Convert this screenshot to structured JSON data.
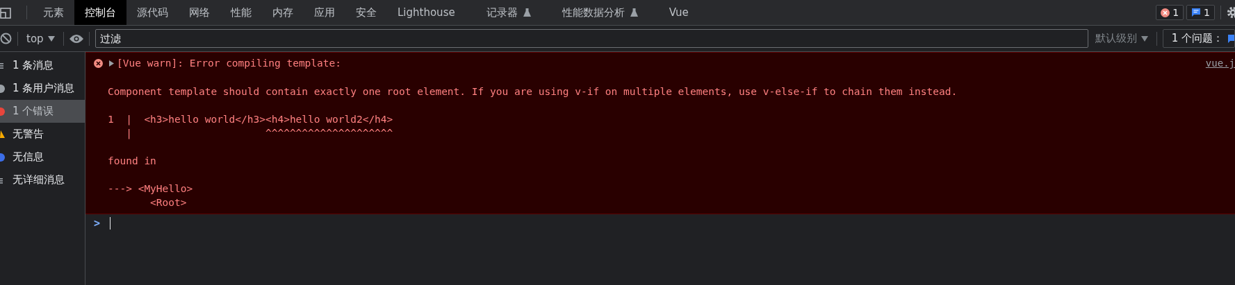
{
  "tabs": [
    {
      "label": "元素",
      "selected": false,
      "flask": false
    },
    {
      "label": "控制台",
      "selected": true,
      "flask": false
    },
    {
      "label": "源代码",
      "selected": false,
      "flask": false
    },
    {
      "label": "网络",
      "selected": false,
      "flask": false
    },
    {
      "label": "性能",
      "selected": false,
      "flask": false
    },
    {
      "label": "内存",
      "selected": false,
      "flask": false
    },
    {
      "label": "应用",
      "selected": false,
      "flask": false
    },
    {
      "label": "安全",
      "selected": false,
      "flask": false
    },
    {
      "label": "Lighthouse",
      "selected": false,
      "flask": false
    },
    {
      "label": "记录器",
      "selected": false,
      "flask": true
    },
    {
      "label": "性能数据分析",
      "selected": false,
      "flask": true
    },
    {
      "label": "Vue",
      "selected": false,
      "flask": false
    }
  ],
  "counters": [
    {
      "kind": "error",
      "count": "1"
    },
    {
      "kind": "message",
      "count": "1"
    }
  ],
  "toolbar": {
    "context": "top",
    "filter": {
      "placeholder": "过滤"
    },
    "levels": "默认级别",
    "issues": "1 个问题："
  },
  "sidebar": {
    "items": [
      {
        "label": "1 条消息",
        "kind": "list",
        "selected": false
      },
      {
        "label": "1 条用户消息",
        "kind": "user",
        "selected": false
      },
      {
        "label": "1 个错误",
        "kind": "error",
        "selected": true
      },
      {
        "label": "无警告",
        "kind": "warning",
        "selected": false
      },
      {
        "label": "无信息",
        "kind": "info",
        "selected": false
      },
      {
        "label": "无详细消息",
        "kind": "verbose",
        "selected": false
      }
    ]
  },
  "console": {
    "messages": [
      {
        "kind": "error",
        "summary": "[Vue warn]: Error compiling template:",
        "source": "vue.j",
        "blocks": [
          [
            "Component template should contain exactly one root element. If you are using v-if on multiple elements, use v-else-if to chain them instead."
          ],
          [
            "1  |  <h3>hello world</h3><h4>hello world2</h4>",
            "   |                      ^^^^^^^^^^^^^^^^^^^^^"
          ],
          [
            "found in"
          ],
          [
            "---> <MyHello>",
            "       <Root>"
          ]
        ]
      }
    ],
    "prompt": ">"
  }
}
